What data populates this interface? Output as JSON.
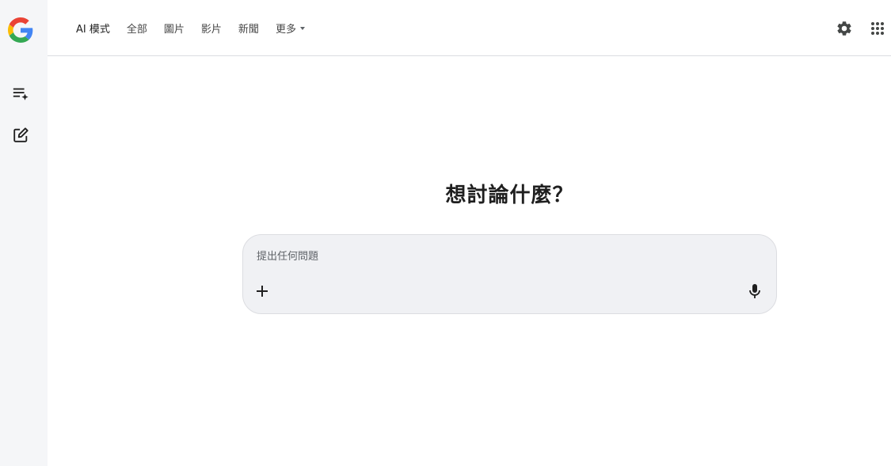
{
  "tabs": [
    {
      "label": "AI 模式",
      "active": true
    },
    {
      "label": "全部",
      "active": false
    },
    {
      "label": "圖片",
      "active": false
    },
    {
      "label": "影片",
      "active": false
    },
    {
      "label": "新聞",
      "active": false
    },
    {
      "label": "更多",
      "active": false,
      "has_dropdown": true
    }
  ],
  "main": {
    "heading": "想討論什麼？"
  },
  "search": {
    "placeholder": "提出任何問題",
    "value": ""
  },
  "icons": {
    "logo": "google-g-logo",
    "sidebar": [
      "history-sparkle-icon",
      "new-chat-icon"
    ],
    "top_right": [
      "gear-icon",
      "apps-grid-icon"
    ],
    "search": [
      "plus-icon",
      "microphone-icon"
    ]
  },
  "colors": {
    "sidebar_bg": "#f5f6f8",
    "search_bg": "#f0f1f4",
    "google_blue": "#4285F4",
    "google_red": "#EA4335",
    "google_yellow": "#FBBC05",
    "google_green": "#34A853"
  }
}
